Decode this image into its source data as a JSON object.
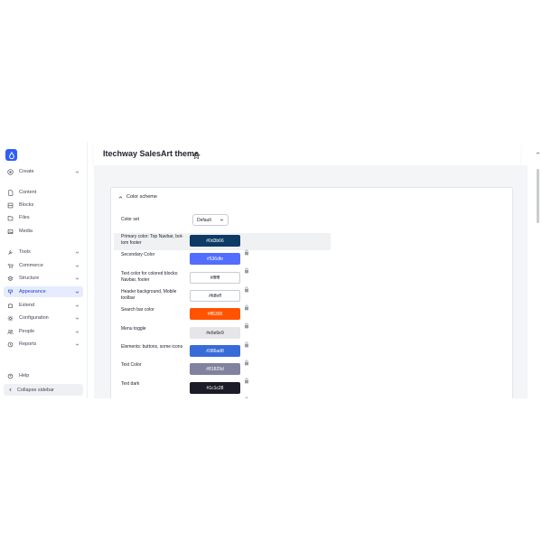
{
  "sidebar": {
    "create": "Create",
    "content": "Content",
    "blocks": "Blocks",
    "files": "Files",
    "media": "Media",
    "tools": "Tools",
    "commerce": "Commerce",
    "structure": "Structure",
    "appearance": "Appearance",
    "extend": "Extend",
    "configuration": "Configuration",
    "people": "People",
    "reports": "Reports",
    "help": "Help",
    "collapse": "Collapse sidebar"
  },
  "page": {
    "title": "Itechway SalesArt theme"
  },
  "scheme": {
    "header": "Color scheme",
    "color_set_label": "Color set",
    "color_set_value": "Default",
    "rows": [
      {
        "label": "Primary color: Top Navbar, bot-tom footer",
        "hex": "#0d3b66",
        "bg": "#0d3b66",
        "fg": "#ffffff"
      },
      {
        "label": "Secondary Color",
        "hex": "#536dfe",
        "bg": "#536dfe",
        "fg": "#ffffff"
      },
      {
        "label": "Text color for colored blocks: Navbar, footer",
        "hex": "#ffffff",
        "bg": "#ffffff",
        "fg": "#222330"
      },
      {
        "label": "Header background, Mobile toolbar",
        "hex": "#fdfeff",
        "bg": "#fdfeff",
        "fg": "#222330"
      },
      {
        "label": "Search bar color",
        "hex": "#ff5300",
        "bg": "#ff5300",
        "fg": "#ffffff"
      },
      {
        "label": "Menu toggle",
        "hex": "#e6e6e9",
        "bg": "#e6e6e9",
        "fg": "#222330"
      },
      {
        "label": "Elements: buttons, some icons",
        "hex": "#386ad8",
        "bg": "#386ad8",
        "fg": "#ffffff"
      },
      {
        "label": "Text Color",
        "hex": "#81829d",
        "bg": "#81829d",
        "fg": "#ffffff"
      },
      {
        "label": "Text dark",
        "hex": "#1c1c28",
        "bg": "#1c1c28",
        "fg": "#ffffff"
      }
    ]
  },
  "colors": {
    "accent": "#2f5ef6",
    "active_bg": "#e6ecfe",
    "main_bg": "#f4f5f7"
  }
}
